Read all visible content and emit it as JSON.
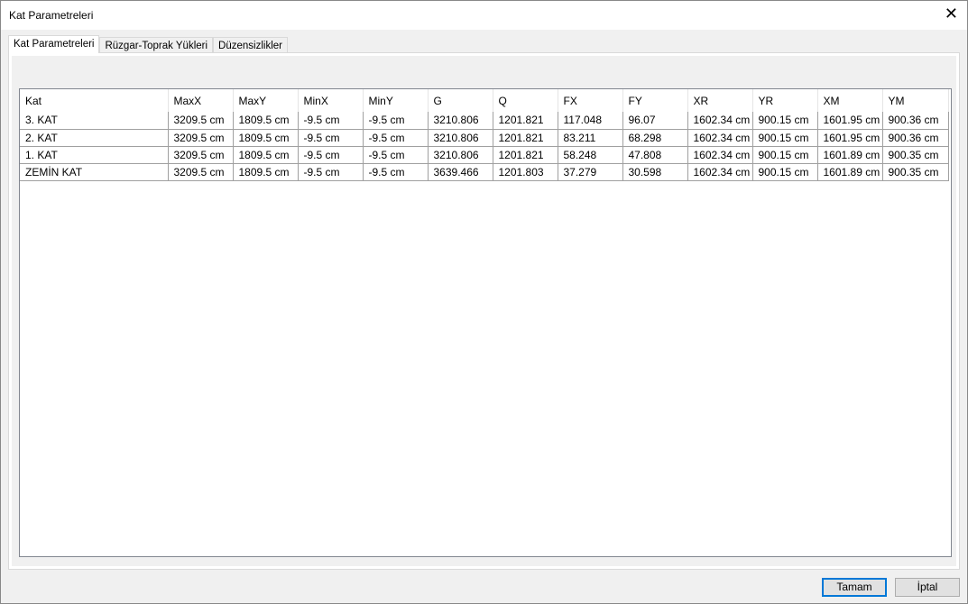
{
  "window": {
    "title": "Kat Parametreleri",
    "close_icon": "close-icon"
  },
  "tabs": [
    {
      "label": "Kat Parametreleri"
    },
    {
      "label": "Rüzgar-Toprak Yükleri"
    },
    {
      "label": "Düzensizlikler"
    }
  ],
  "table": {
    "headers": [
      "Kat",
      "MaxX",
      "MaxY",
      "MinX",
      "MinY",
      "G",
      "Q",
      "FX",
      "FY",
      "XR",
      "YR",
      "XM",
      "YM"
    ],
    "rows": [
      [
        "3. KAT",
        "3209.5 cm",
        "1809.5 cm",
        "-9.5 cm",
        "-9.5 cm",
        "3210.806",
        "1201.821",
        "117.048",
        "96.07",
        "1602.34 cm",
        "900.15 cm",
        "1601.95 cm",
        "900.36 cm"
      ],
      [
        "2. KAT",
        "3209.5 cm",
        "1809.5 cm",
        "-9.5 cm",
        "-9.5 cm",
        "3210.806",
        "1201.821",
        "83.211",
        "68.298",
        "1602.34 cm",
        "900.15 cm",
        "1601.95 cm",
        "900.36 cm"
      ],
      [
        "1. KAT",
        "3209.5 cm",
        "1809.5 cm",
        "-9.5 cm",
        "-9.5 cm",
        "3210.806",
        "1201.821",
        "58.248",
        "47.808",
        "1602.34 cm",
        "900.15 cm",
        "1601.89 cm",
        "900.35 cm"
      ],
      [
        "ZEMİN KAT",
        "3209.5 cm",
        "1809.5 cm",
        "-9.5 cm",
        "-9.5 cm",
        "3639.466",
        "1201.803",
        "37.279",
        "30.598",
        "1602.34 cm",
        "900.15 cm",
        "1601.89 cm",
        "900.35 cm"
      ]
    ]
  },
  "buttons": {
    "ok": "Tamam",
    "cancel": "İptal"
  }
}
